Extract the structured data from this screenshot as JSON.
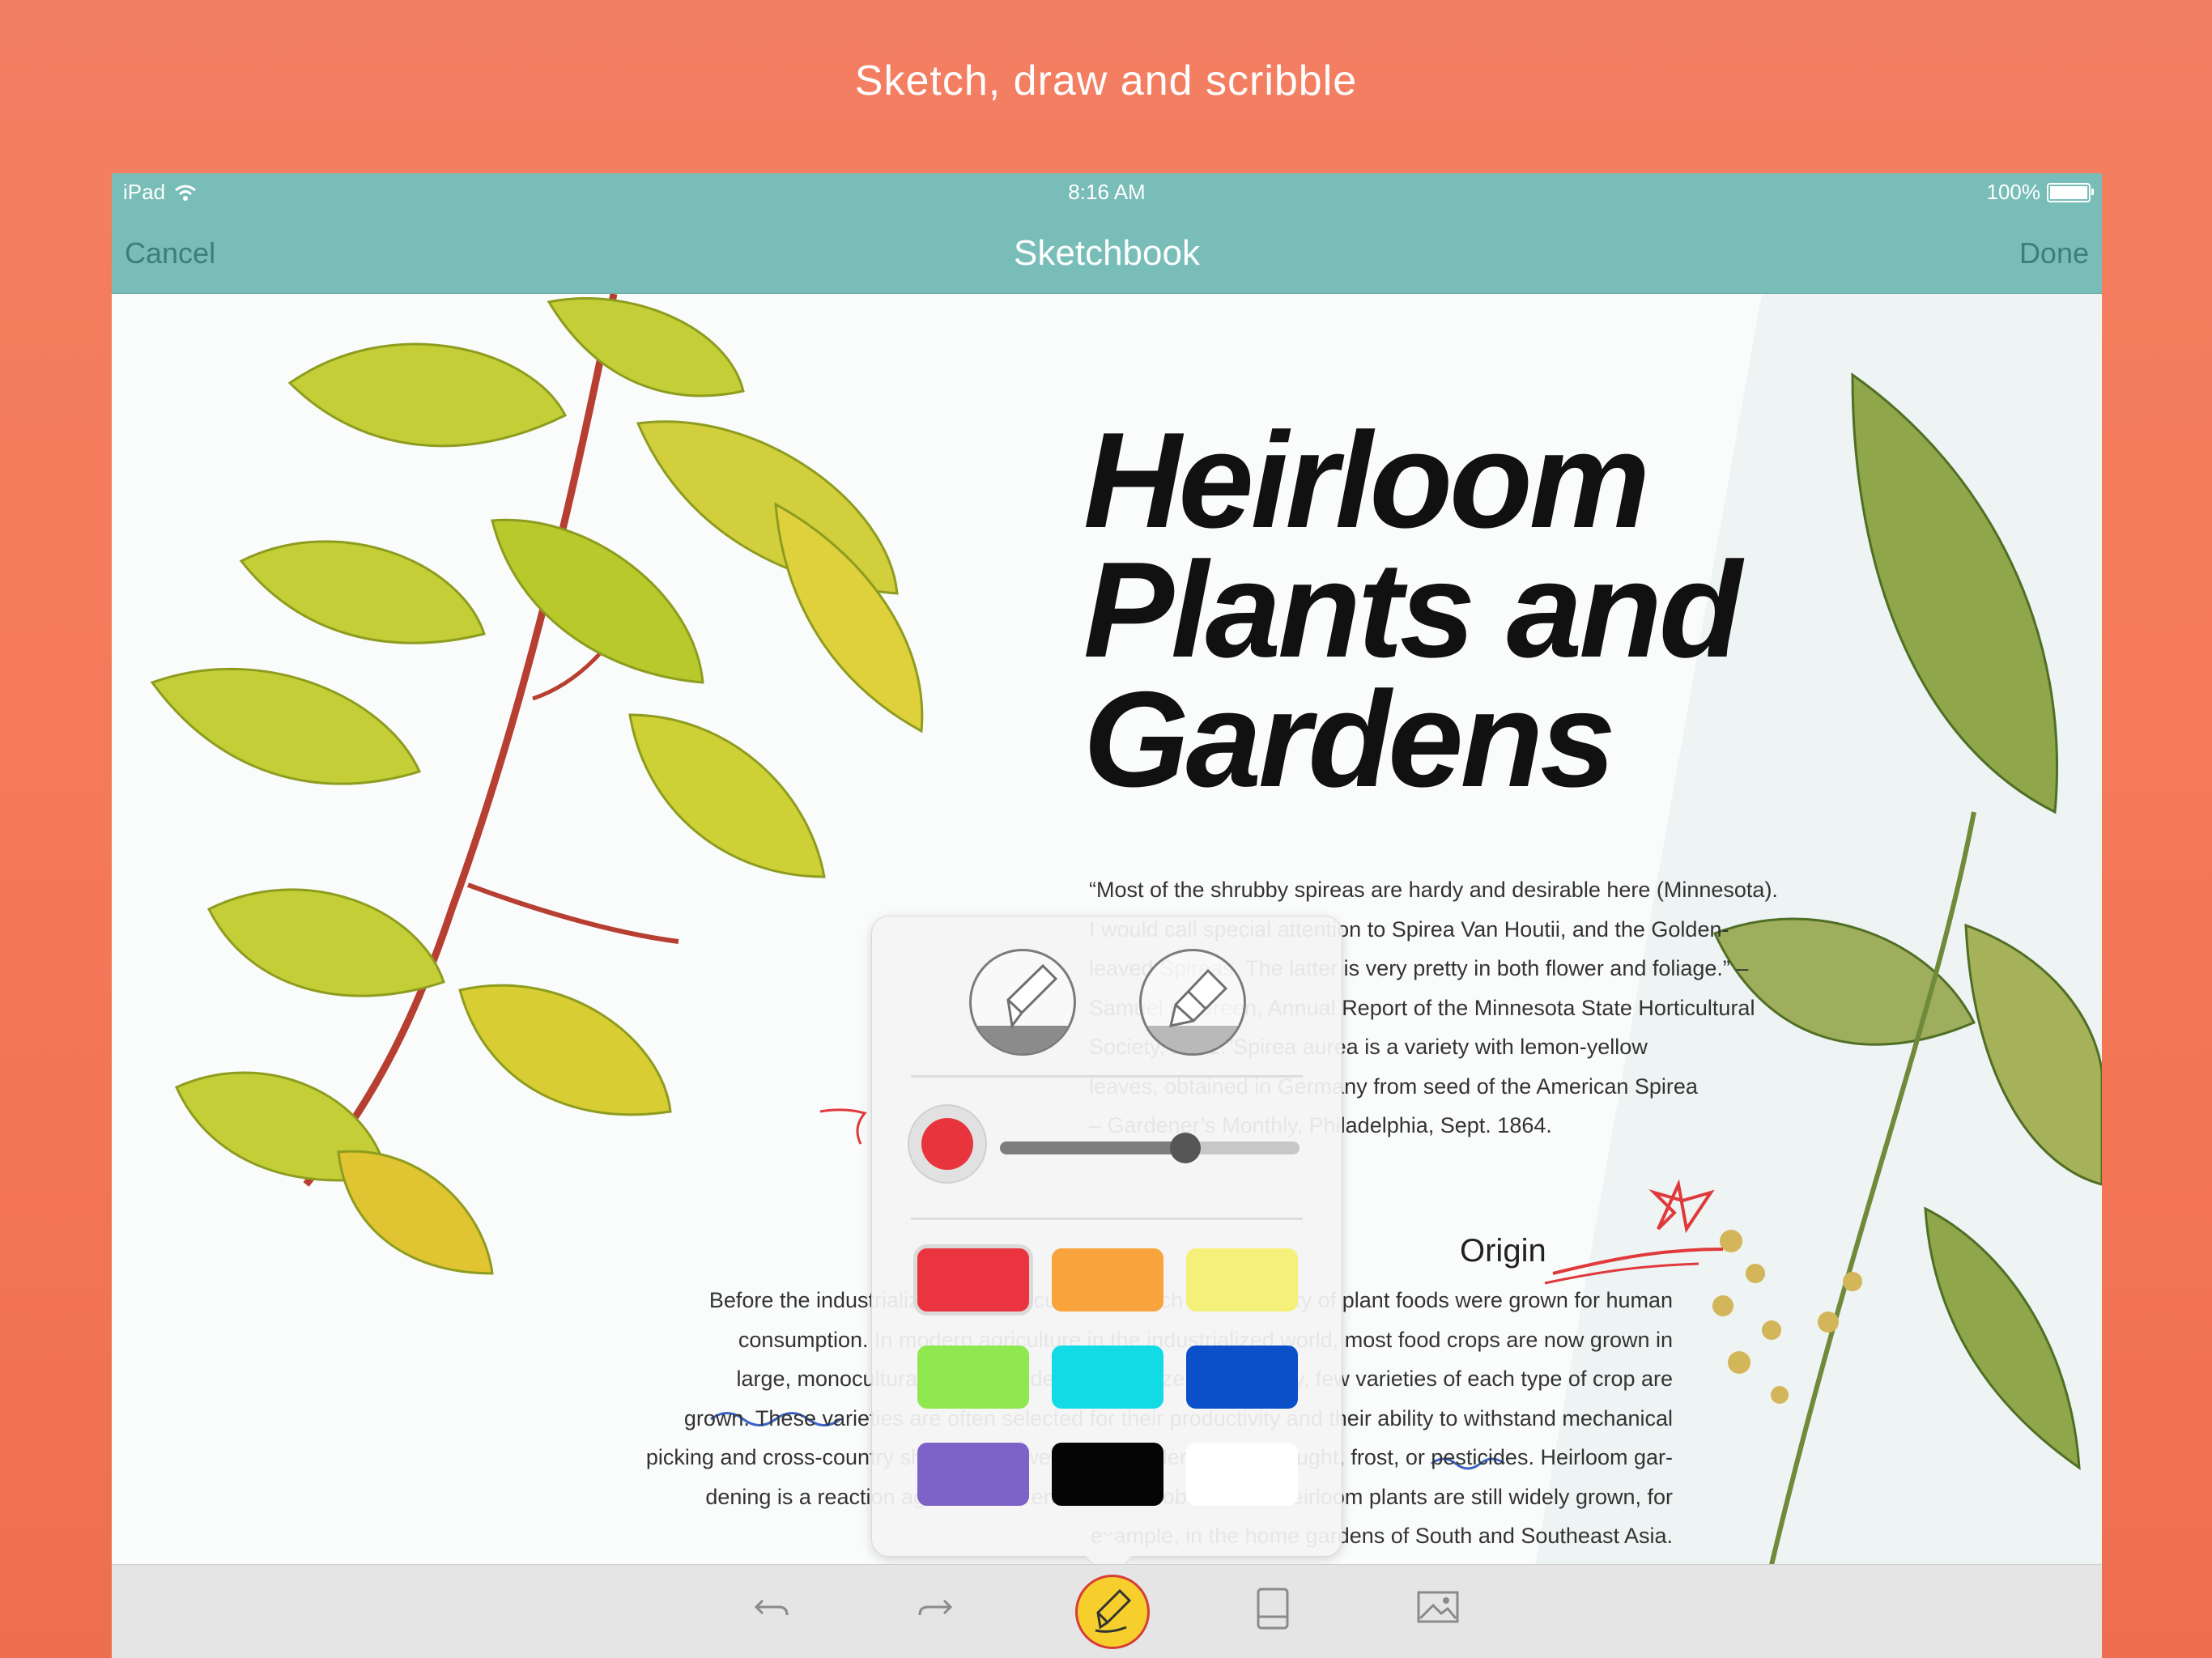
{
  "promo": {
    "caption": "Sketch, draw and scribble"
  },
  "status_bar": {
    "device": "iPad",
    "time": "8:16 AM",
    "battery": "100%",
    "battery_level": 1.0
  },
  "nav_bar": {
    "cancel_label": "Cancel",
    "title": "Sketchbook",
    "done_label": "Done"
  },
  "article": {
    "headline": [
      "Heirloom",
      "Plants and",
      "Gardens"
    ],
    "quote_lines": [
      "“Most of the shrubby spireas are hardy and desirable here (Minnesota).",
      "I would call special attention to Spirea Van Houtii, and the Golden-",
      "leaved Spireas. The latter is very pretty in both flower and foliage.” –",
      "Samuel B. Green, Annual Report of the Minnesota State Horticultural",
      "Society, 1891.”Spirea aurea is a variety with lemon-yellow",
      "leaves, obtained in Germany from seed of the American Spirea",
      "– Gardener’s Monthly, Philadelphia, Sept. 1864."
    ],
    "section_heading": "Origin",
    "body_lines": [
      "Before the industrialization of agriculture, a much wider variety of plant foods were grown for human",
      "consumption. In modern agriculture in the industrialized world, most food crops are now grown in",
      "large, monocultural plots. In order to maximize consistency, few varieties of each type of crop are",
      "grown. These varieties are often selected for their productivity and their ability to withstand mechanical",
      "picking and cross-country shipping, as well as their tolerance to drought, frost, or pesticides. Heirloom gar-",
      "dening is a reaction against this trend. In the Global South, heirloom plants are still widely grown, for",
      "example, in the home gardens of South and Southeast Asia."
    ]
  },
  "tool_popover": {
    "tools": [
      {
        "name": "pen",
        "icon": "pen-tool-icon",
        "selected": true
      },
      {
        "name": "marker",
        "icon": "marker-tool-icon",
        "selected": false
      }
    ],
    "current_color": "#e8343d",
    "stroke_size_fraction": 0.62,
    "swatches": [
      {
        "name": "red",
        "color": "#ea3440",
        "selected": true
      },
      {
        "name": "orange",
        "color": "#f8a33c",
        "selected": false
      },
      {
        "name": "yellow",
        "color": "#f5f07a",
        "selected": false
      },
      {
        "name": "green",
        "color": "#90e850",
        "selected": false
      },
      {
        "name": "cyan",
        "color": "#12dbe6",
        "selected": false
      },
      {
        "name": "blue",
        "color": "#0b50c8",
        "selected": false
      },
      {
        "name": "purple",
        "color": "#7d63c7",
        "selected": false
      },
      {
        "name": "black",
        "color": "#050505",
        "selected": false
      },
      {
        "name": "white",
        "color": "#ffffff",
        "selected": false
      }
    ]
  },
  "toolbar": {
    "buttons": [
      {
        "name": "undo",
        "icon": "undo-icon"
      },
      {
        "name": "redo",
        "icon": "redo-icon"
      },
      {
        "name": "sketch",
        "icon": "sketch-pen-icon",
        "active": true
      },
      {
        "name": "page",
        "icon": "page-icon"
      },
      {
        "name": "image",
        "icon": "image-icon"
      }
    ]
  },
  "colors": {
    "accent_teal": "#79bdb8",
    "background_coral": "#f37f62"
  }
}
